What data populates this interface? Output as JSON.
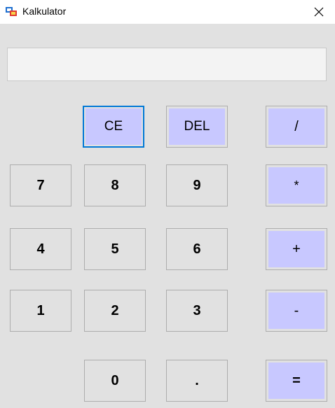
{
  "window": {
    "title": "Kalkulator",
    "icon": "app-calculator-icon",
    "close_icon": "close-icon"
  },
  "display": {
    "value": ""
  },
  "buttons": {
    "ce": "CE",
    "del": "DEL",
    "divide": "/",
    "seven": "7",
    "eight": "8",
    "nine": "9",
    "multiply": "*",
    "four": "4",
    "five": "5",
    "six": "6",
    "plus": "+",
    "one": "1",
    "two": "2",
    "three": "3",
    "minus": "-",
    "zero": "0",
    "dot": ".",
    "equals": "="
  },
  "colors": {
    "operator_fill": "#c8c8ff",
    "background": "#e1e1e1",
    "focus_border": "#0078d7"
  }
}
